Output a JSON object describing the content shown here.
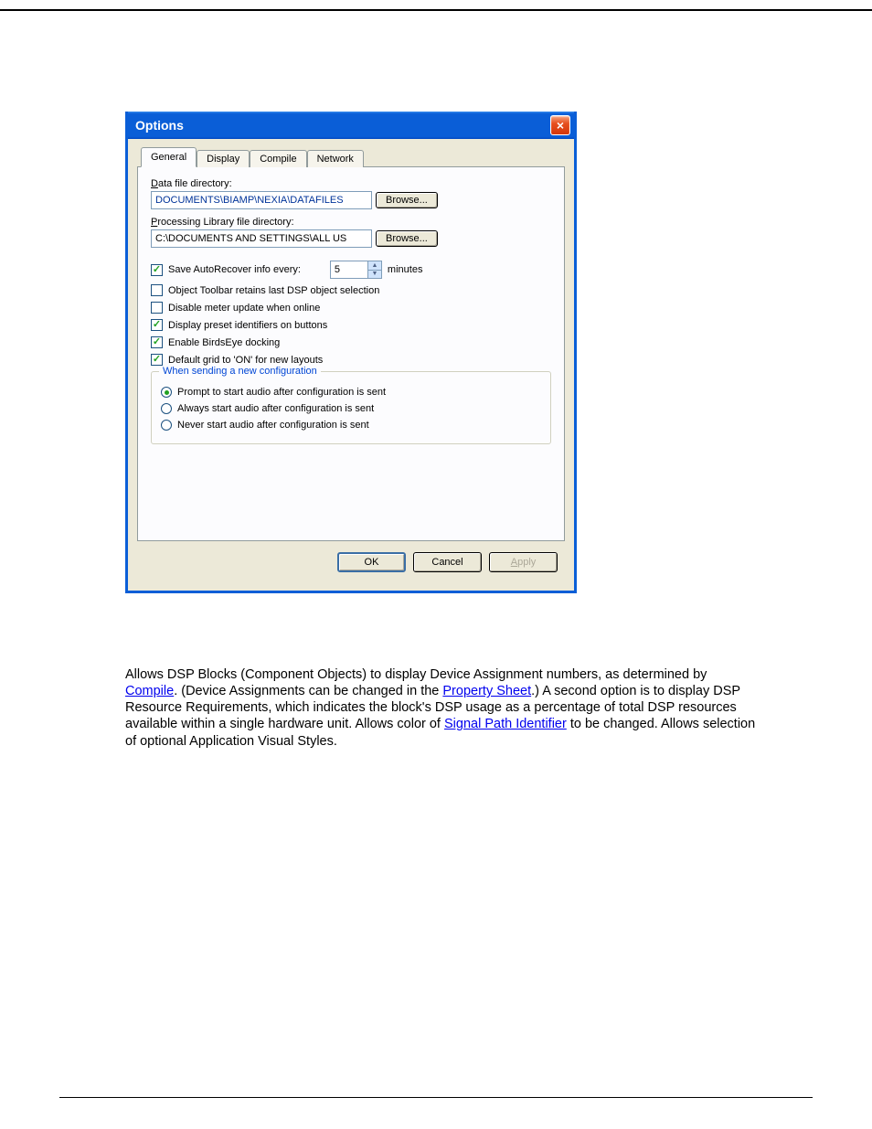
{
  "dialog": {
    "title": "Options",
    "tabs": [
      "General",
      "Display",
      "Compile",
      "Network"
    ],
    "active_tab": 0,
    "data_dir_label": "Data file directory:",
    "data_dir_value": "DOCUMENTS\\BIAMP\\NEXIA\\DATAFILES",
    "lib_dir_label": "Processing Library file directory:",
    "lib_dir_value": "C:\\DOCUMENTS AND SETTINGS\\ALL US",
    "browse_label": "Browse...",
    "autorecover_label": "Save AutoRecover info every:",
    "autorecover_value": "5",
    "autorecover_units": "minutes",
    "checks": {
      "retain": "Object Toolbar retains last DSP object selection",
      "disable_meter": "Disable meter update when online",
      "preset_ids": "Display preset identifiers on buttons",
      "birdseye": "Enable BirdsEye docking",
      "default_grid": "Default grid to 'ON' for new layouts"
    },
    "group_title": "When sending a new configuration",
    "radios": {
      "prompt": "Prompt to start audio after configuration is sent",
      "always": "Always start audio after configuration is sent",
      "never": "Never start audio after configuration is sent"
    },
    "buttons": {
      "ok": "OK",
      "cancel": "Cancel",
      "apply": "Apply"
    }
  },
  "body": {
    "t1": "Allows DSP Blocks (Component Objects) to display Device Assignment numbers, as determined by ",
    "link1": "Compile",
    "t2": ". (Device Assignments can be changed in the ",
    "link2": "Property Sheet",
    "t3": ".) A second option is to display DSP Resource Requirements, which indicates the block's DSP usage as a percentage of total DSP resources available within a single hardware unit. Allows color of ",
    "link3": "Signal Path Identifier",
    "t4": " to be changed. Allows selection of optional Application Visual Styles."
  }
}
